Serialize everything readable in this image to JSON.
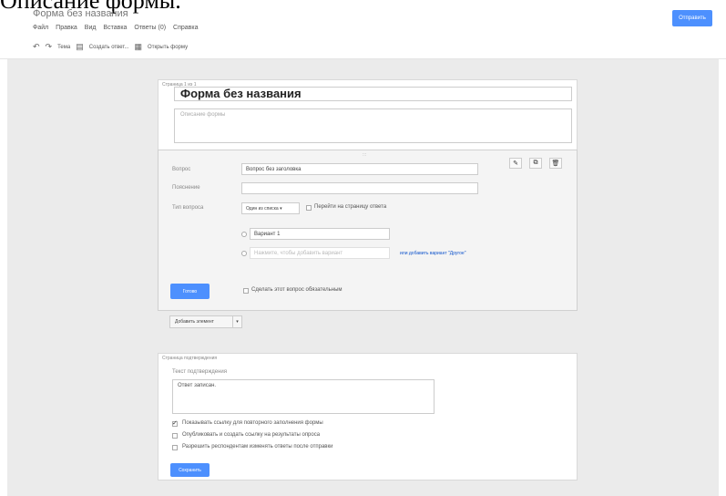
{
  "caption": "Описание формы.",
  "app": {
    "doc_title": "Форма без названия",
    "menu": [
      "Файл",
      "Правка",
      "Вид",
      "Вставка",
      "Ответы (0)",
      "Справка"
    ],
    "send_label": "Отправить"
  },
  "toolbar": {
    "theme_label": "Тема",
    "view_responses_label": "Создать ответ...",
    "view_form_label": "Открыть форму"
  },
  "header_card": {
    "page_label": "Страница 1 из 1",
    "title_value": "Форма без названия",
    "description_placeholder": "Описание формы"
  },
  "question": {
    "drag_handle": ":::",
    "question_label": "Вопрос",
    "question_value": "Вопрос без заголовка",
    "help_label": "Пояснение",
    "help_value": "",
    "type_label": "Тип вопроса",
    "type_value": "Один из списка",
    "goto_page_label": "Перейти на страницу ответа",
    "option1_value": "Вариант 1",
    "add_option_placeholder": "Нажмите, чтобы добавить вариант",
    "add_other_link": "или добавить вариант \"Другое\"",
    "done_label": "Готово",
    "required_label": "Сделать этот вопрос обязательным",
    "edit_icon": "pencil-icon",
    "copy_icon": "copy-icon",
    "delete_icon": "trash-icon"
  },
  "add_item": {
    "label": "Добавить элемент",
    "caret": "▾"
  },
  "confirmation": {
    "page_label": "Страница подтверждения",
    "text_label": "Текст подтверждения",
    "text_value": "Ответ записан.",
    "options": [
      {
        "label": "Показывать ссылку для повторного заполнения формы",
        "checked": true
      },
      {
        "label": "Опубликовать и создать ссылку на результаты опроса",
        "checked": false
      },
      {
        "label": "Разрешить респондентам изменять ответы после отправки",
        "checked": false
      }
    ],
    "save_label": "Сохранить"
  },
  "colors": {
    "accent": "#4d90fe",
    "canvas": "#ebebeb"
  }
}
